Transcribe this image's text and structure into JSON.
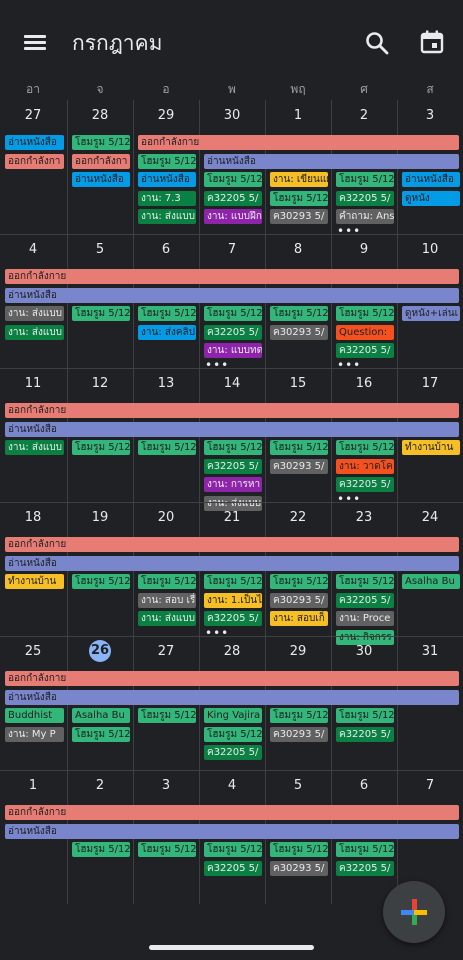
{
  "header": {
    "title": "กรกฎาคม"
  },
  "weekdays": [
    "อา",
    "จ",
    "อ",
    "พ",
    "พฤ",
    "ศ",
    "ส"
  ],
  "weeks": [
    {
      "days": [
        "27",
        "28",
        "29",
        "30",
        "1",
        "2",
        "3"
      ],
      "spans": [
        {
          "start": 2,
          "end": 6,
          "row": 0,
          "text": "ออกกำลังกาย",
          "color": "#e67c73"
        },
        {
          "start": 3,
          "end": 6,
          "row": 1,
          "text": "อ่านหนังสือ",
          "color": "#7986cb"
        }
      ],
      "chips": [
        {
          "col": 0,
          "row": 0,
          "text": "อ่านหนังสือ",
          "color": "#039be5"
        },
        {
          "col": 0,
          "row": 1,
          "text": "ออกกำลังกา",
          "color": "#e67c73"
        },
        {
          "col": 1,
          "row": 0,
          "text": "โฮมรูม 5/12",
          "color": "#33b679"
        },
        {
          "col": 1,
          "row": 1,
          "text": "ออกกำลังกา",
          "color": "#e67c73"
        },
        {
          "col": 1,
          "row": 2,
          "text": "อ่านหนังสือ",
          "color": "#039be5"
        },
        {
          "col": 2,
          "row": 1,
          "text": "โฮมรูม 5/12",
          "color": "#33b679"
        },
        {
          "col": 2,
          "row": 2,
          "text": "อ่านหนังสือ",
          "color": "#039be5"
        },
        {
          "col": 2,
          "row": 3,
          "text": "งาน: 7.3",
          "color": "#0b8043",
          "dark": true
        },
        {
          "col": 2,
          "row": 4,
          "text": "งาน: ส่งแบบ",
          "color": "#0b8043",
          "dark": true
        },
        {
          "col": 3,
          "row": 2,
          "text": "โฮมรูม 5/12",
          "color": "#33b679"
        },
        {
          "col": 3,
          "row": 3,
          "text": "ค32205 5/",
          "color": "#0b8043",
          "dark": true
        },
        {
          "col": 3,
          "row": 4,
          "text": "งาน: แบบฝึก",
          "color": "#8e24aa",
          "dark": true
        },
        {
          "col": 4,
          "row": 2,
          "text": "งาน: เขียนแผ",
          "color": "#f6bf26"
        },
        {
          "col": 4,
          "row": 3,
          "text": "โฮมรูม 5/12",
          "color": "#33b679"
        },
        {
          "col": 4,
          "row": 4,
          "text": "ค30293 5/",
          "color": "#616161",
          "dark": true
        },
        {
          "col": 5,
          "row": 2,
          "text": "โฮมรูม 5/12",
          "color": "#33b679"
        },
        {
          "col": 5,
          "row": 3,
          "text": "ค32205 5/",
          "color": "#0b8043",
          "dark": true
        },
        {
          "col": 5,
          "row": 4,
          "text": "คำถาม: Ans",
          "color": "#616161",
          "dark": true
        },
        {
          "col": 6,
          "row": 2,
          "text": "อ่านหนังสือ",
          "color": "#039be5"
        },
        {
          "col": 6,
          "row": 3,
          "text": "ดูหนัง",
          "color": "#039be5"
        }
      ],
      "more": [
        {
          "col": 5,
          "text": "•••"
        }
      ]
    },
    {
      "days": [
        "4",
        "5",
        "6",
        "7",
        "8",
        "9",
        "10"
      ],
      "spans": [
        {
          "start": 0,
          "end": 6,
          "row": 0,
          "text": "ออกกำลังกาย",
          "color": "#e67c73"
        },
        {
          "start": 0,
          "end": 6,
          "row": 1,
          "text": "อ่านหนังสือ",
          "color": "#7986cb"
        }
      ],
      "chips": [
        {
          "col": 0,
          "row": 2,
          "text": "งาน: ส่งแบบ",
          "color": "#616161",
          "dark": true
        },
        {
          "col": 0,
          "row": 3,
          "text": "งาน: ส่งแบบ",
          "color": "#0b8043",
          "dark": true
        },
        {
          "col": 1,
          "row": 2,
          "text": "โฮมรูม 5/12",
          "color": "#33b679"
        },
        {
          "col": 2,
          "row": 2,
          "text": "โฮมรูม 5/12",
          "color": "#33b679"
        },
        {
          "col": 2,
          "row": 3,
          "text": "งาน: ส่งคลิป",
          "color": "#039be5"
        },
        {
          "col": 3,
          "row": 2,
          "text": "โฮมรูม 5/12",
          "color": "#33b679"
        },
        {
          "col": 3,
          "row": 3,
          "text": "ค32205 5/",
          "color": "#0b8043",
          "dark": true
        },
        {
          "col": 3,
          "row": 4,
          "text": "งาน: แบบทด",
          "color": "#8e24aa",
          "dark": true
        },
        {
          "col": 4,
          "row": 2,
          "text": "โฮมรูม 5/12",
          "color": "#33b679"
        },
        {
          "col": 4,
          "row": 3,
          "text": "ค30293 5/",
          "color": "#616161",
          "dark": true
        },
        {
          "col": 5,
          "row": 2,
          "text": "โฮมรูม 5/12",
          "color": "#33b679"
        },
        {
          "col": 5,
          "row": 3,
          "text": "Question:",
          "color": "#f4511e"
        },
        {
          "col": 5,
          "row": 4,
          "text": "ค32205 5/",
          "color": "#0b8043",
          "dark": true
        },
        {
          "col": 6,
          "row": 2,
          "text": "ดูหนัง+เล่นเ",
          "color": "#7986cb"
        }
      ],
      "more": [
        {
          "col": 3,
          "text": "•••"
        },
        {
          "col": 5,
          "text": "•••"
        }
      ]
    },
    {
      "days": [
        "11",
        "12",
        "13",
        "14",
        "15",
        "16",
        "17"
      ],
      "spans": [
        {
          "start": 0,
          "end": 6,
          "row": 0,
          "text": "ออกกำลังกาย",
          "color": "#e67c73"
        },
        {
          "start": 0,
          "end": 6,
          "row": 1,
          "text": "อ่านหนังสือ",
          "color": "#7986cb"
        }
      ],
      "chips": [
        {
          "col": 0,
          "row": 2,
          "text": "งาน: ส่งแบบ",
          "color": "#0b8043",
          "dark": true
        },
        {
          "col": 1,
          "row": 2,
          "text": "โฮมรูม 5/12",
          "color": "#33b679"
        },
        {
          "col": 2,
          "row": 2,
          "text": "โฮมรูม 5/12",
          "color": "#33b679"
        },
        {
          "col": 3,
          "row": 2,
          "text": "โฮมรูม 5/12",
          "color": "#33b679"
        },
        {
          "col": 3,
          "row": 3,
          "text": "ค32205 5/",
          "color": "#0b8043",
          "dark": true
        },
        {
          "col": 3,
          "row": 4,
          "text": "งาน: การหา",
          "color": "#8e24aa",
          "dark": true
        },
        {
          "col": 3,
          "row": 5,
          "text": "งาน: ส่งแบบ",
          "color": "#616161",
          "dark": true
        },
        {
          "col": 4,
          "row": 2,
          "text": "โฮมรูม 5/12",
          "color": "#33b679"
        },
        {
          "col": 4,
          "row": 3,
          "text": "ค30293 5/",
          "color": "#616161",
          "dark": true
        },
        {
          "col": 5,
          "row": 2,
          "text": "โฮมรูม 5/12",
          "color": "#33b679"
        },
        {
          "col": 5,
          "row": 3,
          "text": "งาน: วาดโค",
          "color": "#f4511e"
        },
        {
          "col": 5,
          "row": 4,
          "text": "ค32205 5/",
          "color": "#0b8043",
          "dark": true
        },
        {
          "col": 6,
          "row": 2,
          "text": "ทำงานบ้าน",
          "color": "#f6bf26"
        }
      ],
      "more": [
        {
          "col": 5,
          "text": "•••"
        }
      ]
    },
    {
      "days": [
        "18",
        "19",
        "20",
        "21",
        "22",
        "23",
        "24"
      ],
      "spans": [
        {
          "start": 0,
          "end": 6,
          "row": 0,
          "text": "ออกกำลังกาย",
          "color": "#e67c73"
        },
        {
          "start": 0,
          "end": 6,
          "row": 1,
          "text": "อ่านหนังสือ",
          "color": "#7986cb"
        }
      ],
      "chips": [
        {
          "col": 0,
          "row": 2,
          "text": "ทำงานบ้าน",
          "color": "#f6bf26"
        },
        {
          "col": 1,
          "row": 2,
          "text": "โฮมรูม 5/12",
          "color": "#33b679"
        },
        {
          "col": 2,
          "row": 2,
          "text": "โฮมรูม 5/12",
          "color": "#33b679"
        },
        {
          "col": 2,
          "row": 3,
          "text": "งาน: สอบ เรื่",
          "color": "#616161",
          "dark": true
        },
        {
          "col": 2,
          "row": 4,
          "text": "งาน: ส่งแบบ",
          "color": "#0b8043",
          "dark": true
        },
        {
          "col": 3,
          "row": 2,
          "text": "โฮมรูม 5/12",
          "color": "#33b679"
        },
        {
          "col": 3,
          "row": 3,
          "text": "งาน: 1.เป็นไ",
          "color": "#f6bf26"
        },
        {
          "col": 3,
          "row": 4,
          "text": "ค32205 5/",
          "color": "#0b8043",
          "dark": true
        },
        {
          "col": 4,
          "row": 2,
          "text": "โฮมรูม 5/12",
          "color": "#33b679"
        },
        {
          "col": 4,
          "row": 3,
          "text": "ค30293 5/",
          "color": "#616161",
          "dark": true
        },
        {
          "col": 4,
          "row": 4,
          "text": "งาน: สอบเก็",
          "color": "#f6bf26"
        },
        {
          "col": 5,
          "row": 2,
          "text": "โฮมรูม 5/12",
          "color": "#33b679"
        },
        {
          "col": 5,
          "row": 3,
          "text": "ค32205 5/",
          "color": "#0b8043",
          "dark": true
        },
        {
          "col": 5,
          "row": 4,
          "text": "งาน: Proce",
          "color": "#616161",
          "dark": true
        },
        {
          "col": 5,
          "row": 5,
          "text": "งาน: กิจกรร",
          "color": "#33b679"
        },
        {
          "col": 6,
          "row": 2,
          "text": "Asalha Bu",
          "color": "#33b679"
        }
      ],
      "more": [
        {
          "col": 3,
          "text": "•••"
        }
      ]
    },
    {
      "days": [
        "25",
        "26",
        "27",
        "28",
        "29",
        "30",
        "31"
      ],
      "today": 1,
      "spans": [
        {
          "start": 0,
          "end": 6,
          "row": 0,
          "text": "ออกกำลังกาย",
          "color": "#e67c73"
        },
        {
          "start": 0,
          "end": 6,
          "row": 1,
          "text": "อ่านหนังสือ",
          "color": "#7986cb"
        }
      ],
      "chips": [
        {
          "col": 0,
          "row": 2,
          "text": "Buddhist",
          "color": "#33b679"
        },
        {
          "col": 0,
          "row": 3,
          "text": "งาน: My P",
          "color": "#616161",
          "dark": true
        },
        {
          "col": 1,
          "row": 2,
          "text": "Asalha Bu",
          "color": "#33b679"
        },
        {
          "col": 1,
          "row": 3,
          "text": "โฮมรูม 5/12",
          "color": "#33b679"
        },
        {
          "col": 2,
          "row": 2,
          "text": "โฮมรูม 5/12",
          "color": "#33b679"
        },
        {
          "col": 3,
          "row": 2,
          "text": "King Vajira",
          "color": "#33b679"
        },
        {
          "col": 3,
          "row": 3,
          "text": "โฮมรูม 5/12",
          "color": "#33b679"
        },
        {
          "col": 3,
          "row": 4,
          "text": "ค32205 5/",
          "color": "#0b8043",
          "dark": true
        },
        {
          "col": 4,
          "row": 2,
          "text": "โฮมรูม 5/12",
          "color": "#33b679"
        },
        {
          "col": 4,
          "row": 3,
          "text": "ค30293 5/",
          "color": "#616161",
          "dark": true
        },
        {
          "col": 5,
          "row": 2,
          "text": "โฮมรูม 5/12",
          "color": "#33b679"
        },
        {
          "col": 5,
          "row": 3,
          "text": "ค32205 5/",
          "color": "#0b8043",
          "dark": true
        }
      ],
      "more": []
    },
    {
      "days": [
        "1",
        "2",
        "3",
        "4",
        "5",
        "6",
        "7"
      ],
      "spans": [
        {
          "start": 0,
          "end": 6,
          "row": 0,
          "text": "ออกกำลังกาย",
          "color": "#e67c73"
        },
        {
          "start": 0,
          "end": 6,
          "row": 1,
          "text": "อ่านหนังสือ",
          "color": "#7986cb"
        }
      ],
      "chips": [
        {
          "col": 1,
          "row": 2,
          "text": "โฮมรูม 5/12",
          "color": "#33b679"
        },
        {
          "col": 2,
          "row": 2,
          "text": "โฮมรูม 5/12",
          "color": "#33b679"
        },
        {
          "col": 3,
          "row": 2,
          "text": "โฮมรูม 5/12",
          "color": "#33b679"
        },
        {
          "col": 3,
          "row": 3,
          "text": "ค32205 5/",
          "color": "#0b8043",
          "dark": true
        },
        {
          "col": 4,
          "row": 2,
          "text": "โฮมรูม 5/12",
          "color": "#33b679"
        },
        {
          "col": 4,
          "row": 3,
          "text": "ค30293 5/",
          "color": "#616161",
          "dark": true
        },
        {
          "col": 5,
          "row": 2,
          "text": "โฮมรูม 5/12",
          "color": "#33b679"
        },
        {
          "col": 5,
          "row": 3,
          "text": "ค32205 5/",
          "color": "#0b8043",
          "dark": true
        }
      ],
      "more": []
    }
  ]
}
